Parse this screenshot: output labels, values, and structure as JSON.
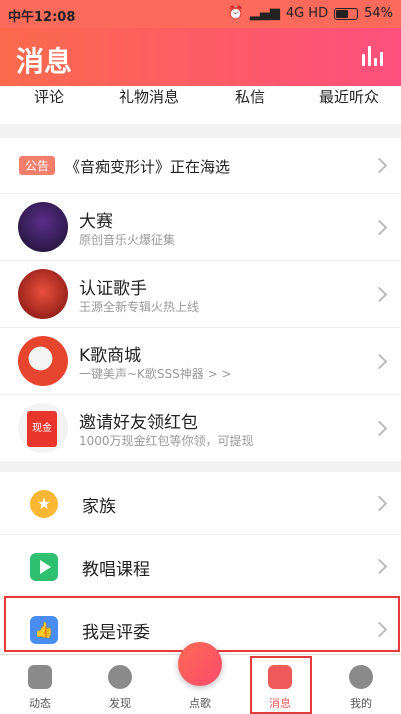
{
  "status_bar": {
    "time": "中午12:08",
    "network": "4G HD",
    "battery": "54%"
  },
  "header": {
    "title": "消息"
  },
  "tabs": [
    "评论",
    "礼物消息",
    "私信",
    "最近听众"
  ],
  "notice": {
    "badge": "公告",
    "text": "《音痴变形计》正在海选"
  },
  "messages": [
    {
      "title": "大赛",
      "subtitle": "原创音乐火爆征集"
    },
    {
      "title": "认证歌手",
      "subtitle": "王源全新专辑火热上线"
    },
    {
      "title": "K歌商城",
      "subtitle": "一键美声~K歌SSS神器 > >"
    },
    {
      "title": "邀请好友领红包",
      "subtitle": "1000万现金红包等你领，可提现",
      "avatar_text": "现金"
    }
  ],
  "menu": [
    {
      "label": "家族",
      "icon": "star-hexagon-icon",
      "color": "#f7b733"
    },
    {
      "label": "教唱课程",
      "icon": "play-icon",
      "color": "#2fbf71"
    },
    {
      "label": "我是评委",
      "icon": "thumbs-up-icon",
      "color": "#4a8df0"
    }
  ],
  "bottom_nav": [
    "动态",
    "发现",
    "点歌",
    "消息",
    "我的"
  ],
  "colors": {
    "accent": "#fb5b5b",
    "header_start": "#fb6a4c",
    "header_end": "#fe4f7e"
  }
}
